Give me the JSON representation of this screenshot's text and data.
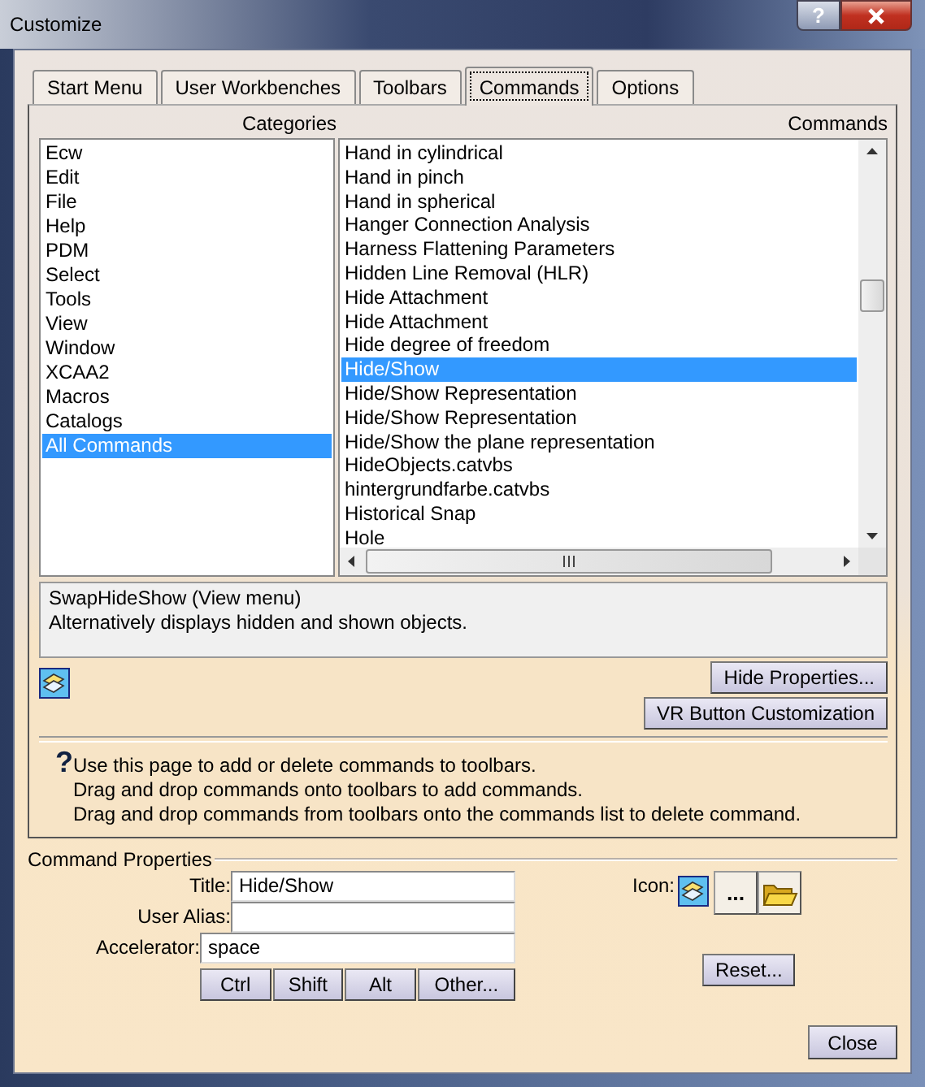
{
  "window": {
    "title": "Customize",
    "help_button": "?"
  },
  "tabs": [
    {
      "label": "Start Menu",
      "selected": false
    },
    {
      "label": "User Workbenches",
      "selected": false
    },
    {
      "label": "Toolbars",
      "selected": false
    },
    {
      "label": "Commands",
      "selected": true
    },
    {
      "label": "Options",
      "selected": false
    }
  ],
  "categories": {
    "header": "Categories",
    "items": [
      {
        "label": "Ecw",
        "selected": false
      },
      {
        "label": "Edit",
        "selected": false
      },
      {
        "label": "File",
        "selected": false
      },
      {
        "label": "Help",
        "selected": false
      },
      {
        "label": "PDM",
        "selected": false
      },
      {
        "label": "Select",
        "selected": false
      },
      {
        "label": "Tools",
        "selected": false
      },
      {
        "label": "View",
        "selected": false
      },
      {
        "label": "Window",
        "selected": false
      },
      {
        "label": "XCAA2",
        "selected": false
      },
      {
        "label": "Macros",
        "selected": false
      },
      {
        "label": "Catalogs",
        "selected": false
      },
      {
        "label": "All Commands",
        "selected": true
      }
    ]
  },
  "commands": {
    "header": "Commands",
    "items": [
      {
        "label": "Hand in cylindrical",
        "selected": false
      },
      {
        "label": "Hand in pinch",
        "selected": false
      },
      {
        "label": "Hand in spherical",
        "selected": false
      },
      {
        "label": "Hanger Connection Analysis",
        "selected": false
      },
      {
        "label": "Harness Flattening Parameters",
        "selected": false
      },
      {
        "label": "Hidden Line Removal (HLR)",
        "selected": false
      },
      {
        "label": "Hide Attachment",
        "selected": false
      },
      {
        "label": "Hide Attachment",
        "selected": false
      },
      {
        "label": "Hide degree of freedom",
        "selected": false
      },
      {
        "label": "Hide/Show",
        "selected": true
      },
      {
        "label": "Hide/Show Representation",
        "selected": false
      },
      {
        "label": "Hide/Show Representation",
        "selected": false
      },
      {
        "label": "Hide/Show the plane representation",
        "selected": false
      },
      {
        "label": "HideObjects.catvbs",
        "selected": false
      },
      {
        "label": "hintergrundfarbe.catvbs",
        "selected": false
      },
      {
        "label": "Historical Snap",
        "selected": false
      },
      {
        "label": "Hole",
        "selected": false
      }
    ]
  },
  "description": [
    "SwapHideShow (View menu)",
    "Alternatively displays hidden and shown objects."
  ],
  "panel_buttons": [
    "Hide Properties...",
    "VR Button Customization"
  ],
  "help": {
    "mark": "?",
    "lines": [
      "Use this page to add or delete commands to toolbars.",
      "Drag and drop commands onto toolbars to add commands.",
      "Drag and drop commands from toolbars onto the commands list to delete command."
    ]
  },
  "command_properties": {
    "legend": "Command Properties",
    "fields": [
      {
        "label": "Title:",
        "value": "Hide/Show"
      },
      {
        "label": "User Alias:"
      },
      {
        "label": "Accelerator:",
        "value": "space"
      }
    ],
    "modifier_buttons": [
      "Ctrl",
      "Shift",
      "Alt",
      "Other..."
    ],
    "icon_label": "Icon:",
    "browse_button": "...",
    "reset_button": "Reset..."
  },
  "close_button": "Close"
}
